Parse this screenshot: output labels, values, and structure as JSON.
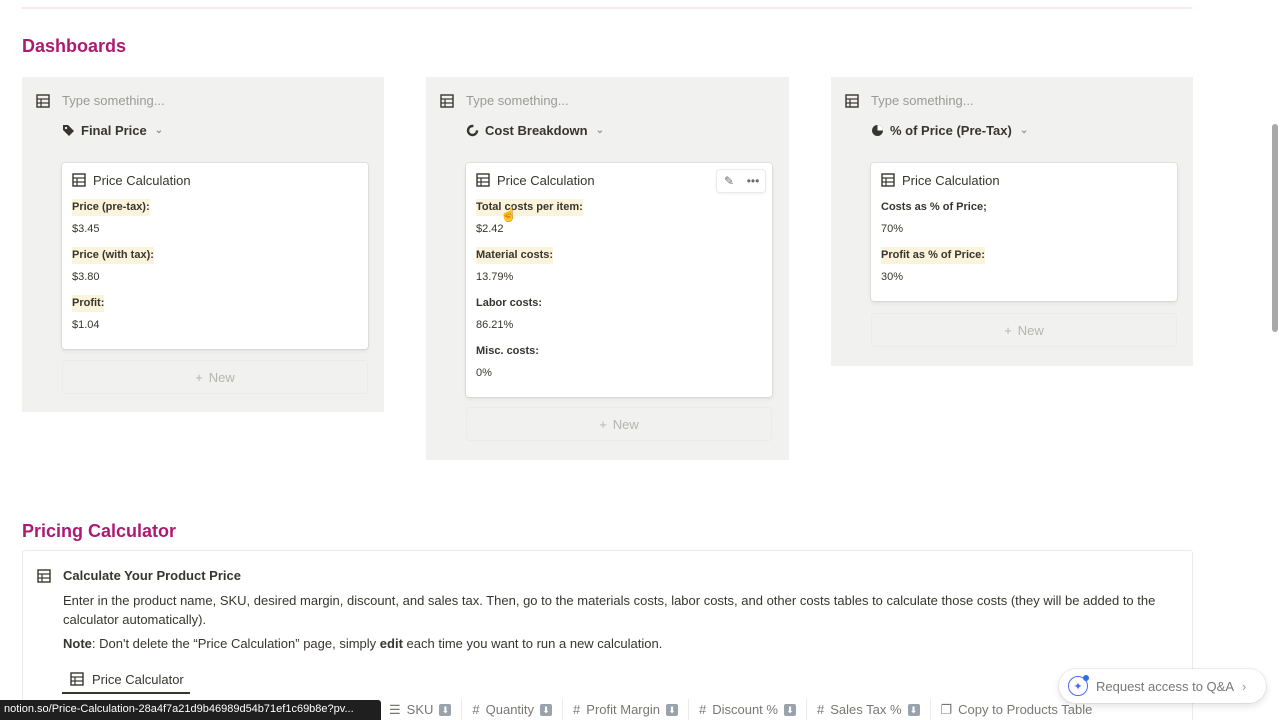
{
  "sections": {
    "dashboards_title": "Dashboards",
    "pricing_title": "Pricing Calculator"
  },
  "boards": [
    {
      "placeholder": "Type something...",
      "view_label": "Final Price",
      "view_icon": "tag-icon",
      "card_title": "Price Calculation",
      "props": [
        {
          "label": "Price (pre-tax):",
          "value": "$3.45"
        },
        {
          "label": "Price (with tax):",
          "value": "$3.80"
        },
        {
          "label": "Profit:",
          "value": "$1.04"
        }
      ],
      "new_label": "New"
    },
    {
      "placeholder": "Type something...",
      "view_label": "Cost Breakdown",
      "view_icon": "donut-chart-icon",
      "card_title": "Price Calculation",
      "props": [
        {
          "label": "Total costs per item:",
          "value": "$2.42"
        },
        {
          "label": "Material costs:",
          "value": "13.79%"
        },
        {
          "label": "Labor costs:",
          "value": "86.21%"
        },
        {
          "label": "Misc. costs:",
          "value": "0%"
        }
      ],
      "new_label": "New"
    },
    {
      "placeholder": "Type something...",
      "view_label": "% of Price (Pre-Tax)",
      "view_icon": "pie-chart-icon",
      "card_title": "Price Calculation",
      "props": [
        {
          "label": "Costs as % of Price;",
          "value": "70%"
        },
        {
          "label": "Profit as % of Price:",
          "value": "30%"
        }
      ],
      "new_label": "New"
    }
  ],
  "callout": {
    "title": "Calculate Your Product Price",
    "text": "Enter in the product name, SKU, desired margin, discount, and sales tax. Then, go to the materials costs, labor costs, and other costs tables to calculate those costs (they will be added to the calculator automatically).",
    "note_label": "Note",
    "note_text_1": ": Don't delete the “Price Calculation” page, simply ",
    "note_bold": "edit",
    "note_text_2": " each time you want to run a new calculation."
  },
  "calc_tab": "Price Calculator",
  "table_columns": [
    {
      "icon": "list-icon",
      "label": "SKU"
    },
    {
      "icon": "hash-icon",
      "label": "Quantity"
    },
    {
      "icon": "hash-icon",
      "label": "Profit Margin"
    },
    {
      "icon": "hash-icon",
      "label": "Discount %"
    },
    {
      "icon": "hash-icon",
      "label": "Sales Tax %"
    },
    {
      "icon": "copy-icon",
      "label": "Copy to Products Table"
    }
  ],
  "status_url": "notion.so/Price-Calculation-28a4f7a21d9b46989d54b71ef1c69b8e?pv...",
  "qa": {
    "label": "Request access to Q&A"
  }
}
